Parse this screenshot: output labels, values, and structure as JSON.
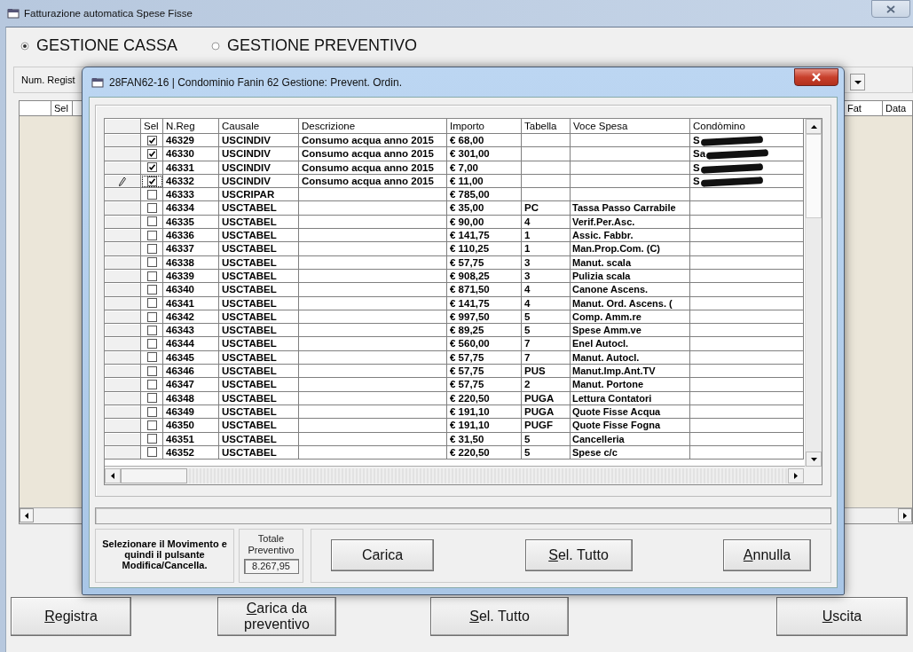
{
  "window": {
    "title": "Fatturazione automatica Spese Fisse"
  },
  "modes": [
    {
      "label": "GESTIONE CASSA",
      "selected": true
    },
    {
      "label": "GESTIONE PREVENTIVO",
      "selected": false
    }
  ],
  "filter": {
    "label": "Num. Regist"
  },
  "background_grid": {
    "columns_left": [
      "Sel"
    ],
    "columns_right": [
      "Fat",
      "Data"
    ]
  },
  "buttons": [
    {
      "label": "Registra",
      "mnemonic": true
    },
    {
      "label": "Carica da preventivo",
      "mnemonic": true
    },
    {
      "label": "Sel. Tutto",
      "mnemonic": true
    },
    {
      "label": "Uscita",
      "mnemonic": true
    }
  ],
  "dialog": {
    "title": "28FAN62-16 | Condominio Fanin 62 Gestione: Prevent. Ordin.",
    "table": {
      "columns": [
        "Sel",
        "N.Reg",
        "Causale",
        "Descrizione",
        "Importo",
        "Tabella",
        "Voce Spesa",
        "Condòmino"
      ],
      "rows": [
        {
          "selected": true,
          "editing": false,
          "nreg": "46329",
          "causale": "USCINDIV",
          "descrizione": "Consumo acqua anno 2015",
          "importo": "€ 68,00",
          "tabella": "",
          "voce": "",
          "condomino": "S",
          "redacted": true
        },
        {
          "selected": true,
          "editing": false,
          "nreg": "46330",
          "causale": "USCINDIV",
          "descrizione": "Consumo acqua anno 2015",
          "importo": "€ 301,00",
          "tabella": "",
          "voce": "",
          "condomino": "Sa",
          "redacted": true
        },
        {
          "selected": true,
          "editing": false,
          "nreg": "46331",
          "causale": "USCINDIV",
          "descrizione": "Consumo acqua anno 2015",
          "importo": "€ 7,00",
          "tabella": "",
          "voce": "",
          "condomino": "S",
          "redacted": true
        },
        {
          "selected": true,
          "editing": true,
          "nreg": "46332",
          "causale": "USCINDIV",
          "descrizione": "Consumo acqua anno 2015",
          "importo": "€ 11,00",
          "tabella": "",
          "voce": "",
          "condomino": "S",
          "redacted": true
        },
        {
          "selected": false,
          "editing": false,
          "nreg": "46333",
          "causale": "USCRIPAR",
          "descrizione": "",
          "importo": "€ 785,00",
          "tabella": "",
          "voce": "",
          "condomino": "",
          "redacted": false
        },
        {
          "selected": false,
          "editing": false,
          "nreg": "46334",
          "causale": "USCTABEL",
          "descrizione": "",
          "importo": "€ 35,00",
          "tabella": "PC",
          "voce": "Tassa Passo Carrabile",
          "condomino": "",
          "redacted": false
        },
        {
          "selected": false,
          "editing": false,
          "nreg": "46335",
          "causale": "USCTABEL",
          "descrizione": "",
          "importo": "€ 90,00",
          "tabella": "4",
          "voce": "Verif.Per.Asc.",
          "condomino": "",
          "redacted": false
        },
        {
          "selected": false,
          "editing": false,
          "nreg": "46336",
          "causale": "USCTABEL",
          "descrizione": "",
          "importo": "€ 141,75",
          "tabella": "1",
          "voce": "Assic. Fabbr.",
          "condomino": "",
          "redacted": false
        },
        {
          "selected": false,
          "editing": false,
          "nreg": "46337",
          "causale": "USCTABEL",
          "descrizione": "",
          "importo": "€ 110,25",
          "tabella": "1",
          "voce": "Man.Prop.Com. (C)",
          "condomino": "",
          "redacted": false
        },
        {
          "selected": false,
          "editing": false,
          "nreg": "46338",
          "causale": "USCTABEL",
          "descrizione": "",
          "importo": "€ 57,75",
          "tabella": "3",
          "voce": "Manut. scala",
          "condomino": "",
          "redacted": false
        },
        {
          "selected": false,
          "editing": false,
          "nreg": "46339",
          "causale": "USCTABEL",
          "descrizione": "",
          "importo": "€ 908,25",
          "tabella": "3",
          "voce": "Pulizia scala",
          "condomino": "",
          "redacted": false
        },
        {
          "selected": false,
          "editing": false,
          "nreg": "46340",
          "causale": "USCTABEL",
          "descrizione": "",
          "importo": "€ 871,50",
          "tabella": "4",
          "voce": "Canone Ascens.",
          "condomino": "",
          "redacted": false
        },
        {
          "selected": false,
          "editing": false,
          "nreg": "46341",
          "causale": "USCTABEL",
          "descrizione": "",
          "importo": "€ 141,75",
          "tabella": "4",
          "voce": "Manut. Ord. Ascens. (",
          "condomino": "",
          "redacted": false
        },
        {
          "selected": false,
          "editing": false,
          "nreg": "46342",
          "causale": "USCTABEL",
          "descrizione": "",
          "importo": "€ 997,50",
          "tabella": "5",
          "voce": "Comp. Amm.re",
          "condomino": "",
          "redacted": false
        },
        {
          "selected": false,
          "editing": false,
          "nreg": "46343",
          "causale": "USCTABEL",
          "descrizione": "",
          "importo": "€ 89,25",
          "tabella": "5",
          "voce": "Spese Amm.ve",
          "condomino": "",
          "redacted": false
        },
        {
          "selected": false,
          "editing": false,
          "nreg": "46344",
          "causale": "USCTABEL",
          "descrizione": "",
          "importo": "€ 560,00",
          "tabella": "7",
          "voce": "Enel Autocl.",
          "condomino": "",
          "redacted": false
        },
        {
          "selected": false,
          "editing": false,
          "nreg": "46345",
          "causale": "USCTABEL",
          "descrizione": "",
          "importo": "€ 57,75",
          "tabella": "7",
          "voce": "Manut. Autocl.",
          "condomino": "",
          "redacted": false
        },
        {
          "selected": false,
          "editing": false,
          "nreg": "46346",
          "causale": "USCTABEL",
          "descrizione": "",
          "importo": "€ 57,75",
          "tabella": "PUS",
          "voce": "Manut.Imp.Ant.TV",
          "condomino": "",
          "redacted": false
        },
        {
          "selected": false,
          "editing": false,
          "nreg": "46347",
          "causale": "USCTABEL",
          "descrizione": "",
          "importo": "€ 57,75",
          "tabella": "2",
          "voce": "Manut. Portone",
          "condomino": "",
          "redacted": false
        },
        {
          "selected": false,
          "editing": false,
          "nreg": "46348",
          "causale": "USCTABEL",
          "descrizione": "",
          "importo": "€ 220,50",
          "tabella": "PUGA",
          "voce": "Lettura Contatori",
          "condomino": "",
          "redacted": false
        },
        {
          "selected": false,
          "editing": false,
          "nreg": "46349",
          "causale": "USCTABEL",
          "descrizione": "",
          "importo": "€ 191,10",
          "tabella": "PUGA",
          "voce": "Quote Fisse Acqua",
          "condomino": "",
          "redacted": false
        },
        {
          "selected": false,
          "editing": false,
          "nreg": "46350",
          "causale": "USCTABEL",
          "descrizione": "",
          "importo": "€ 191,10",
          "tabella": "PUGF",
          "voce": "Quote Fisse Fogna",
          "condomino": "",
          "redacted": false
        },
        {
          "selected": false,
          "editing": false,
          "nreg": "46351",
          "causale": "USCTABEL",
          "descrizione": "",
          "importo": "€ 31,50",
          "tabella": "5",
          "voce": "Cancelleria",
          "condomino": "",
          "redacted": false
        },
        {
          "selected": false,
          "editing": false,
          "nreg": "46352",
          "causale": "USCTABEL",
          "descrizione": "",
          "importo": "€ 220,50",
          "tabella": "5",
          "voce": "Spese c/c",
          "condomino": "",
          "redacted": false
        }
      ]
    },
    "instructions": "Selezionare il Movimento e quindi il pulsante Modifica/Cancella.",
    "total": {
      "label": "Totale Preventivo",
      "value": "8.267,95"
    },
    "buttons": [
      {
        "label": "Carica",
        "mnemonic": false
      },
      {
        "label": "Sel. Tutto",
        "mnemonic": true
      },
      {
        "label": "Annulla",
        "mnemonic": true
      }
    ]
  }
}
